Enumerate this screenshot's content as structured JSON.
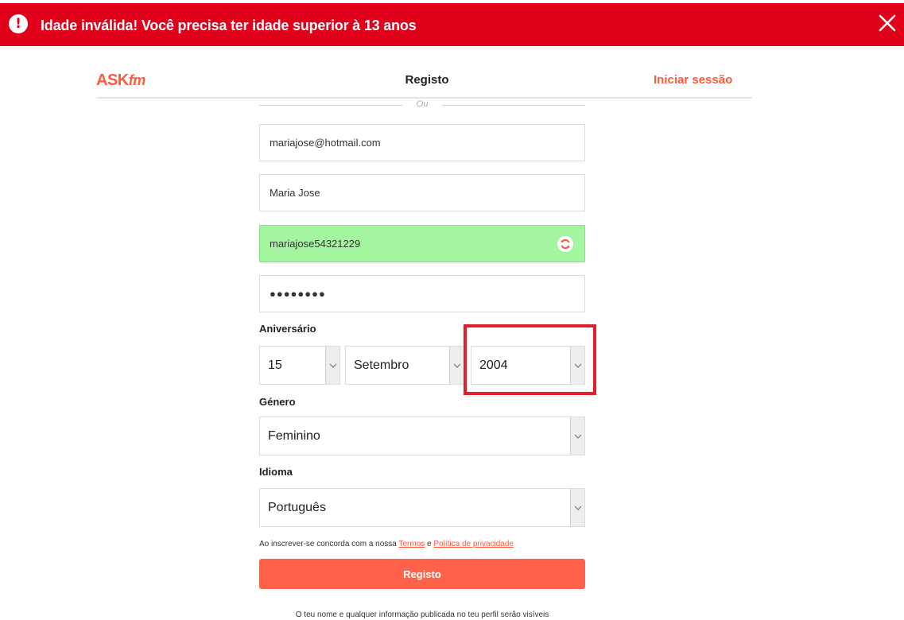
{
  "error_banner": {
    "message": "Idade inválida! Você precisa ter idade superior à 13 anos",
    "icon": "exclamation-icon",
    "close_icon": "close-icon",
    "color": "#e00019"
  },
  "header": {
    "logo_main": "ASK",
    "logo_suffix": "fm",
    "title": "Registo",
    "login_link": "Iniciar sessão",
    "accent_color": "#ff5a3c"
  },
  "separator": {
    "text": "Ou"
  },
  "form": {
    "email": "mariajose@hotmail.com",
    "name": "Maria Jose",
    "username": "mariajose54321229",
    "username_icon": "refresh-icon",
    "password": "●●●●●●●●",
    "birthday_label": "Aniversário",
    "birthday": {
      "day": "15",
      "month": "Setembro",
      "year": "2004"
    },
    "gender_label": "Género",
    "gender": "Feminino",
    "language_label": "Idioma",
    "language": "Português"
  },
  "terms": {
    "prefix": "Ao inscrever-se concorda com a nossa ",
    "terms_link": "Termos",
    "and": " e ",
    "privacy_link": "Política de privacidade"
  },
  "submit_label": "Registo",
  "footer_note": "O teu nome e qualquer informação publicada no teu perfil serão visíveis"
}
